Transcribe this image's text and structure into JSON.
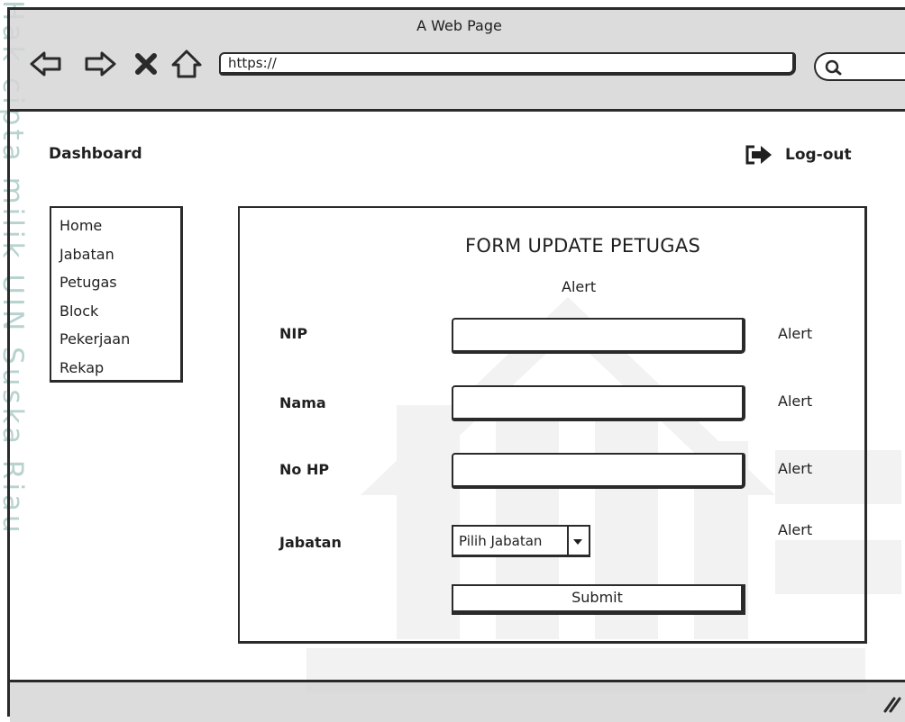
{
  "browser": {
    "title": "A Web Page",
    "url": "https://"
  },
  "watermark": {
    "text": "Hak cipta milik UIN Suska Riau"
  },
  "header": {
    "dashboard_label": "Dashboard",
    "logout_label": "Log-out"
  },
  "sidebar": {
    "items": [
      {
        "label": "Home"
      },
      {
        "label": "Jabatan"
      },
      {
        "label": "Petugas"
      },
      {
        "label": "Block"
      },
      {
        "label": "Pekerjaan"
      },
      {
        "label": "Rekap"
      }
    ]
  },
  "form": {
    "title": "FORM UPDATE PETUGAS",
    "alert_top": "Alert",
    "fields": [
      {
        "label": "NIP",
        "value": "",
        "alert": "Alert"
      },
      {
        "label": "Nama",
        "value": "",
        "alert": "Alert"
      },
      {
        "label": "No HP",
        "value": "",
        "alert": "Alert"
      }
    ],
    "jabatan": {
      "label": "Jabatan",
      "selected": "Pilih Jabatan",
      "alert": "Alert"
    },
    "submit_label": "Submit"
  },
  "colors": {
    "chrome_bg": "#d6d6d6",
    "stroke": "#2a2a2a",
    "watermark": "#b8d2cf"
  }
}
